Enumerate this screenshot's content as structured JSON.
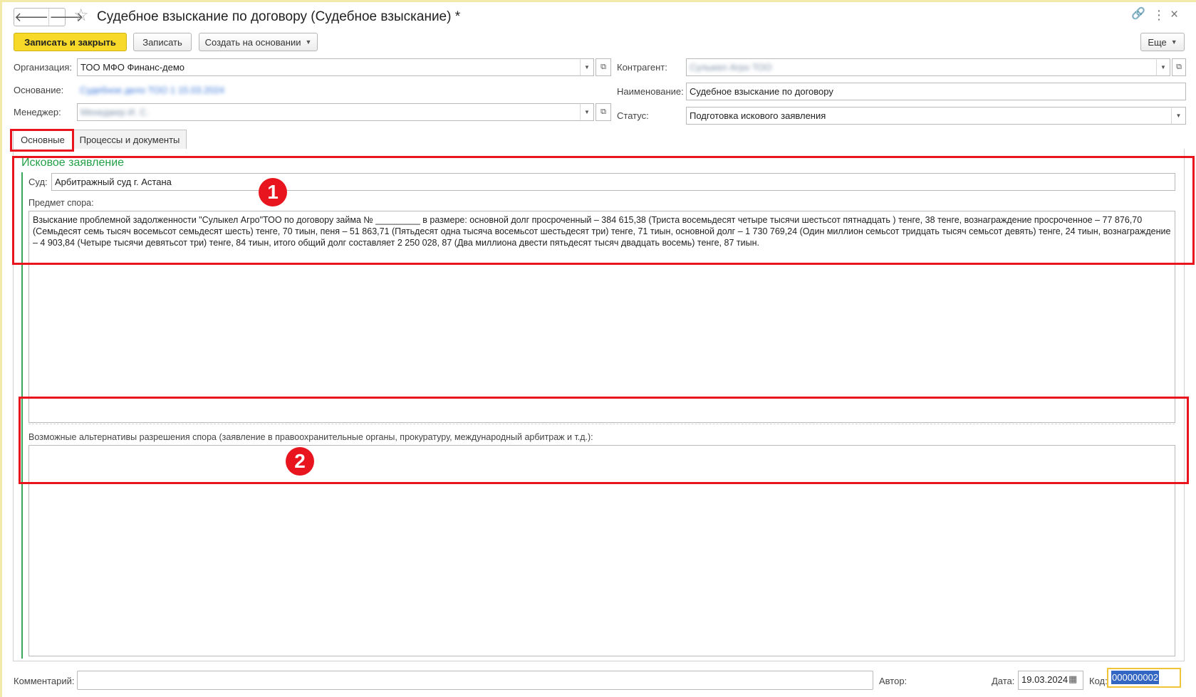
{
  "window": {
    "title": "Судебное взыскание по договору (Судебное взыскание) *",
    "back_icon": "🡐",
    "forward_icon": "🡒",
    "star_icon": "☆",
    "link_icon": "🔗",
    "more_icon": "⋮",
    "close_icon": "×"
  },
  "toolbar": {
    "save_close_label": "Записать и закрыть",
    "save_label": "Записать",
    "create_based_label": "Создать на основании",
    "more_label": "Еще"
  },
  "header": {
    "organization": {
      "label": "Организация:",
      "value": "ТОО МФО Финанс-демо"
    },
    "basis": {
      "label": "Основание:",
      "value": "Судебное дело ТОО 1 15.03.2024"
    },
    "manager": {
      "label": "Менеджер:",
      "value": "Менеджер И. С."
    },
    "counterparty": {
      "label": "Контрагент:",
      "value": "Сулыкел Агро ТОО"
    },
    "name": {
      "label": "Наименование:",
      "value": "Судебное взыскание по договору"
    },
    "status": {
      "label": "Статус:",
      "value": "Подготовка искового заявления"
    }
  },
  "tabs": [
    {
      "label": "Основные"
    },
    {
      "label": "Процессы и документы"
    }
  ],
  "claim": {
    "group_title": "Исковое заявление",
    "court": {
      "label": "Суд:",
      "value": "Арбитражный суд г. Астана"
    },
    "subject": {
      "label": "Предмет спора:",
      "value": "Взыскание проблемной задолженности  \"Сулыкел Агро\"ТОО по договору займа № _________ в размере: основной долг просроченный – 384 615,38 (Триста восемьдесят четыре тысячи шестьсот пятнадцать ) тенге, 38 тенге, вознаграждение просроченное – 77 876,70 (Семьдесят семь тысяч восемьсот семьдесят шесть) тенге, 70 тиын, пеня – 51 863,71 (Пятьдесят одна тысяча восемьсот шестьдесят три) тенге, 71 тиын, основной долг – 1 730 769,24 (Один миллион семьсот тридцать тысяч семьсот девять) тенге, 24 тиын, вознаграждение – 4 903,84 (Четыре тысячи девятьсот три) тенге, 84 тиын, итого общий долг составляет 2 250 028, 87 (Два миллиона двести пятьдесят тысяч двадцать восемь) тенге, 87 тиын."
    },
    "alternatives": {
      "label": "Возможные альтернативы разрешения спора (заявление в правоохранительные органы, прокуратуру, международный арбитраж и т.д.):",
      "value": ""
    }
  },
  "annotations": [
    {
      "label": "1"
    },
    {
      "label": "2"
    }
  ],
  "footer": {
    "comment_label": "Комментарий:",
    "comment_value": "",
    "author_label": "Автор:",
    "date_label": "Дата:",
    "date_value": "19.03.2024",
    "calendar_icon": "▦",
    "code_label": "Код:",
    "code_value": "000000002"
  },
  "colors": {
    "primary_button": "#f7d92a",
    "group_title": "#23a047",
    "annotation_red": "#e8141e",
    "selection": "#3266c2"
  }
}
